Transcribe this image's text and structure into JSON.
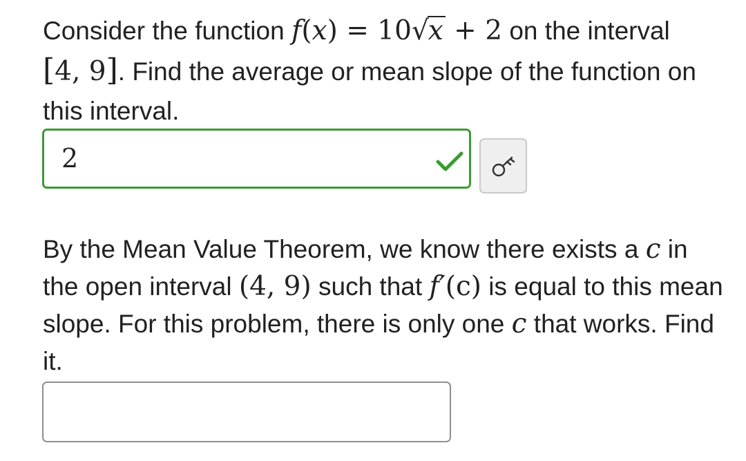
{
  "question1": {
    "intro": "Consider the function ",
    "f_name": "f",
    "lparen": "(",
    "var": "x",
    "rparen": ")",
    "equals": " = 10",
    "radicand": "x",
    "plus_term": " + 2",
    "after_function": " on the interval ",
    "interval_open": "[",
    "interval_values": "4, 9",
    "interval_close": "]",
    "after_interval": ". Find the average or mean slope of the function on this interval."
  },
  "answer1": {
    "value": "2",
    "status": "correct",
    "status_color": "#3a9b35"
  },
  "hint_button": {
    "icon": "key-icon"
  },
  "question2": {
    "text_a": "By the Mean Value Theorem, we know there exists a ",
    "c1": "c",
    "text_b": " in the open interval ",
    "open_interval": "(4, 9)",
    "text_c": " such that ",
    "fprime": "f′",
    "fprime_arg": "(c)",
    "text_d": " is equal to this mean slope. For this problem, there is only one ",
    "c2": "c",
    "text_e": " that works. Find it."
  },
  "answer2": {
    "value": "",
    "placeholder": ""
  }
}
